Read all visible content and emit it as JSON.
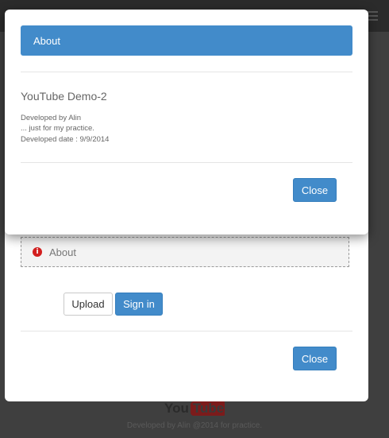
{
  "background": {
    "about_label": "About",
    "upload_label": "Upload",
    "signin_label": "Sign in",
    "close_label": "Close",
    "logo_you": "You",
    "logo_tube": "Tube",
    "footer": "Developed by Alin @2014 for practice."
  },
  "dialog": {
    "header": "About",
    "app_title": "YouTube Demo-2",
    "lines": [
      "Developed by Alin",
      "... just for my practice.",
      "Developed date : 9/9/2014"
    ],
    "close_label": "Close"
  },
  "colors": {
    "primary": "#428bca",
    "overlay": "#3f3f3f",
    "info_icon": "#d21f1f"
  },
  "icons": {
    "info": "info-icon",
    "menu": "menu-icon"
  }
}
